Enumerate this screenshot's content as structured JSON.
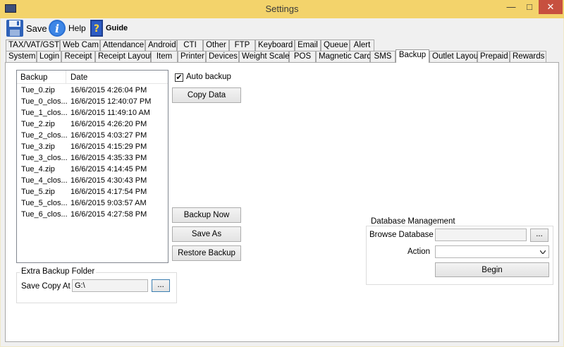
{
  "window": {
    "title": "Settings",
    "min": "—",
    "max": "□",
    "close": "✕"
  },
  "toolbar": {
    "save": "Save",
    "help": "Help",
    "guide": "Guide"
  },
  "tabs_row1": [
    "TAX/VAT/GST",
    "Web Cam",
    "Attendance",
    "Android",
    "CTI",
    "Other",
    "FTP",
    "Keyboard",
    "Email",
    "Queue",
    "Alert"
  ],
  "tabs_row2": [
    "System",
    "Login",
    "Receipt",
    "Receipt Layout",
    "Item",
    "Printer",
    "Devices",
    "Weight Scale",
    "POS",
    "Magnetic Card",
    "SMS",
    "Backup",
    "Outlet Layout",
    "Prepaid",
    "Rewards"
  ],
  "active_tab": "Backup",
  "backup_list": {
    "columns": [
      "Backup",
      "Date"
    ],
    "rows": [
      [
        "Tue_0.zip",
        "16/6/2015 4:26:04 PM"
      ],
      [
        "Tue_0_clos...",
        "16/6/2015 12:40:07 PM"
      ],
      [
        "Tue_1_clos...",
        "16/6/2015 11:49:10 AM"
      ],
      [
        "Tue_2.zip",
        "16/6/2015 4:26:20 PM"
      ],
      [
        "Tue_2_clos...",
        "16/6/2015 4:03:27 PM"
      ],
      [
        "Tue_3.zip",
        "16/6/2015 4:15:29 PM"
      ],
      [
        "Tue_3_clos...",
        "16/6/2015 4:35:33 PM"
      ],
      [
        "Tue_4.zip",
        "16/6/2015 4:14:45 PM"
      ],
      [
        "Tue_4_clos...",
        "16/6/2015 4:30:43 PM"
      ],
      [
        "Tue_5.zip",
        "16/6/2015 4:17:54 PM"
      ],
      [
        "Tue_5_clos...",
        "16/6/2015 9:03:57 AM"
      ],
      [
        "Tue_6_clos...",
        "16/6/2015 4:27:58 PM"
      ]
    ]
  },
  "auto_backup": {
    "label": "Auto backup",
    "checked": true,
    "mark": "✔"
  },
  "buttons": {
    "copy_data": "Copy Data",
    "backup_now": "Backup Now",
    "save_as": "Save As",
    "restore_backup": "Restore Backup"
  },
  "extra_backup": {
    "legend": "Extra Backup Folder",
    "label": "Save Copy At",
    "value": "G:\\",
    "browse": "..."
  },
  "db_management": {
    "legend": "Database Management",
    "browse_label": "Browse Database",
    "browse_value": "",
    "browse_button": "...",
    "action_label": "Action",
    "action_value": "",
    "begin": "Begin"
  }
}
